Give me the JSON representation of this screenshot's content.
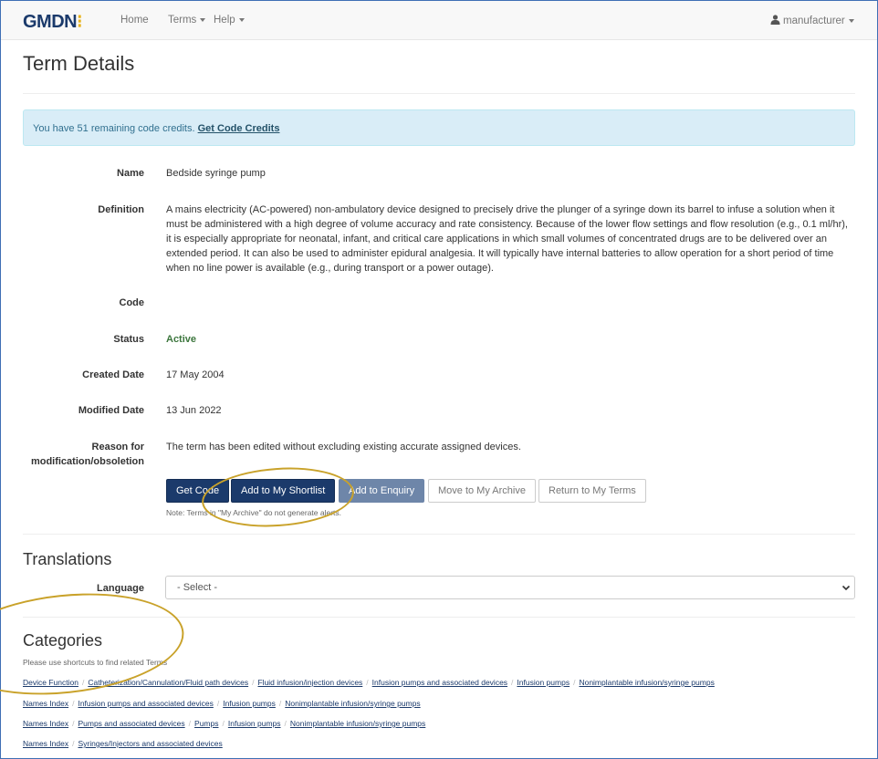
{
  "nav": {
    "logo_text": "GMDN",
    "logo_dots": "⁝",
    "home": "Home",
    "terms": "Terms",
    "help": "Help",
    "user": "manufacturer"
  },
  "page": {
    "title": "Term Details",
    "alert_text": "You have 51 remaining code credits.",
    "alert_link": "Get Code Credits"
  },
  "fields": {
    "name_label": "Name",
    "name_value": "Bedside syringe pump",
    "definition_label": "Definition",
    "definition_value": "A mains electricity (AC-powered) non-ambulatory device designed to precisely drive the plunger of a syringe down its barrel to infuse a solution when it must be administered with a high degree of volume accuracy and rate consistency. Because of the lower flow settings and flow resolution (e.g., 0.1 ml/hr), it is especially appropriate for neonatal, infant, and critical care applications in which small volumes of concentrated drugs are to be delivered over an extended period. It can also be used to administer epidural analgesia. It will typically have internal batteries to allow operation for a short period of time when no line power is available (e.g., during transport or a power outage).",
    "code_label": "Code",
    "code_value": "",
    "status_label": "Status",
    "status_value": "Active",
    "created_label": "Created Date",
    "created_value": "17 May 2004",
    "modified_label": "Modified Date",
    "modified_value": "13 Jun 2022",
    "reason_label": "Reason for modification/obsoletion",
    "reason_value": "The term has been edited without excluding existing accurate assigned devices."
  },
  "actions": {
    "get_code": "Get Code",
    "add_shortlist": "Add to My Shortlist",
    "add_enquiry": "Add to Enquiry",
    "move_archive": "Move to My Archive",
    "return_terms": "Return to My Terms",
    "note": "Note: Terms in \"My Archive\" do not generate alerts."
  },
  "translations": {
    "title": "Translations",
    "language_label": "Language",
    "select_value": "- Select -"
  },
  "categories": {
    "title": "Categories",
    "help": "Please use shortcuts to find related Terms",
    "rows": [
      [
        "Device Function",
        "Catheterization/Cannulation/Fluid path devices",
        "Fluid infusion/injection devices",
        "Infusion pumps and associated devices",
        "Infusion pumps",
        "Nonimplantable infusion/syringe pumps"
      ],
      [
        "Names Index",
        "Infusion pumps and associated devices",
        "Infusion pumps",
        "Nonimplantable infusion/syringe pumps"
      ],
      [
        "Names Index",
        "Pumps and associated devices",
        "Pumps",
        "Infusion pumps",
        "Nonimplantable infusion/syringe pumps"
      ],
      [
        "Names Index",
        "Syringes/Injectors and associated devices"
      ]
    ]
  },
  "colors": {
    "brand_navy": "#1b3a6b",
    "logo_accent": "#e8b21b",
    "highlight_circle": "#c9a22a",
    "status_active": "#3c763d"
  }
}
